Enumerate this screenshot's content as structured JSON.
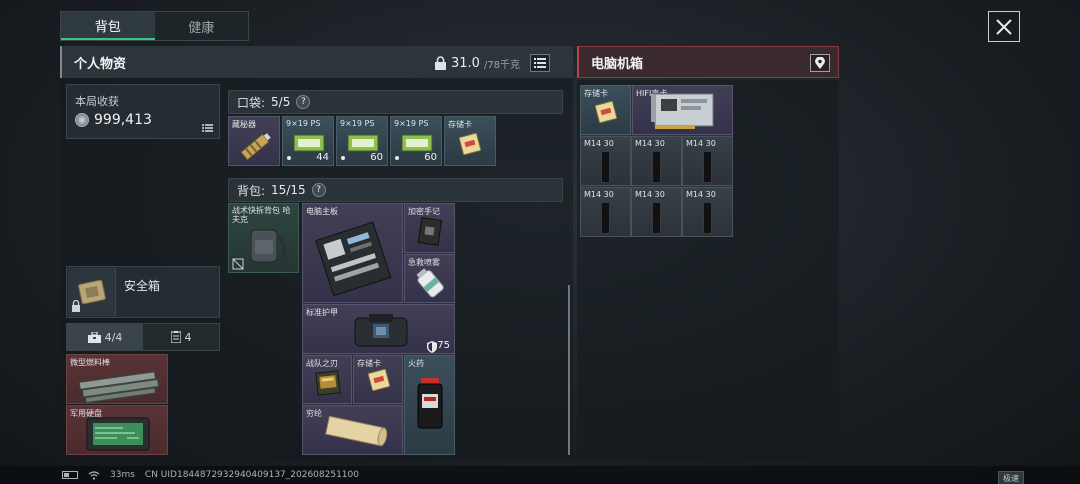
{
  "tabs": [
    {
      "label": "背包",
      "active": true
    },
    {
      "label": "健康",
      "active": false
    }
  ],
  "personal": {
    "title": "个人物资",
    "weight_current": "31.0",
    "weight_max": "/78千克"
  },
  "earnings": {
    "label": "本局收获",
    "value": "999,413"
  },
  "safe_box": {
    "label": "安全箱"
  },
  "sub_tabs": [
    {
      "icon": "toolbox-icon",
      "label": "4/4",
      "active": true
    },
    {
      "icon": "clipboard-icon",
      "label": "4",
      "active": false
    }
  ],
  "safe_items": [
    {
      "label": "微型燃料棒"
    },
    {
      "label": "军用硬盘"
    }
  ],
  "pocket": {
    "title": "口袋:",
    "count": "5/5",
    "help": "?",
    "items": [
      {
        "label": "藏秘器",
        "count": ""
      },
      {
        "label": "9×19 PS",
        "count": "44"
      },
      {
        "label": "9×19 PS",
        "count": "60"
      },
      {
        "label": "9×19 PS",
        "count": "60"
      },
      {
        "label": "存储卡",
        "count": ""
      }
    ]
  },
  "backpack": {
    "title": "背包:",
    "count": "15/15",
    "help": "?",
    "equipped": {
      "label": "战术快拆背包 哈夫克"
    },
    "items": [
      {
        "label": "电脑主板"
      },
      {
        "label": "加密手记"
      },
      {
        "label": "急救喷雾"
      },
      {
        "label": "标准护甲",
        "durability": "75"
      },
      {
        "label": "战队之刃"
      },
      {
        "label": "存储卡"
      },
      {
        "label": "火药"
      },
      {
        "label": "穷纶"
      }
    ]
  },
  "pc_case": {
    "title": "电脑机箱",
    "items": [
      {
        "label": "存储卡"
      },
      {
        "label": "HIFI声卡"
      }
    ],
    "ram": [
      "M14 30",
      "M14 30",
      "M14 30",
      "M14 30",
      "M14 30",
      "M14 30"
    ]
  },
  "status": {
    "latency": "33ms",
    "uid": "CN UID1844872932940409137_202608251100",
    "net_button": "极速"
  }
}
